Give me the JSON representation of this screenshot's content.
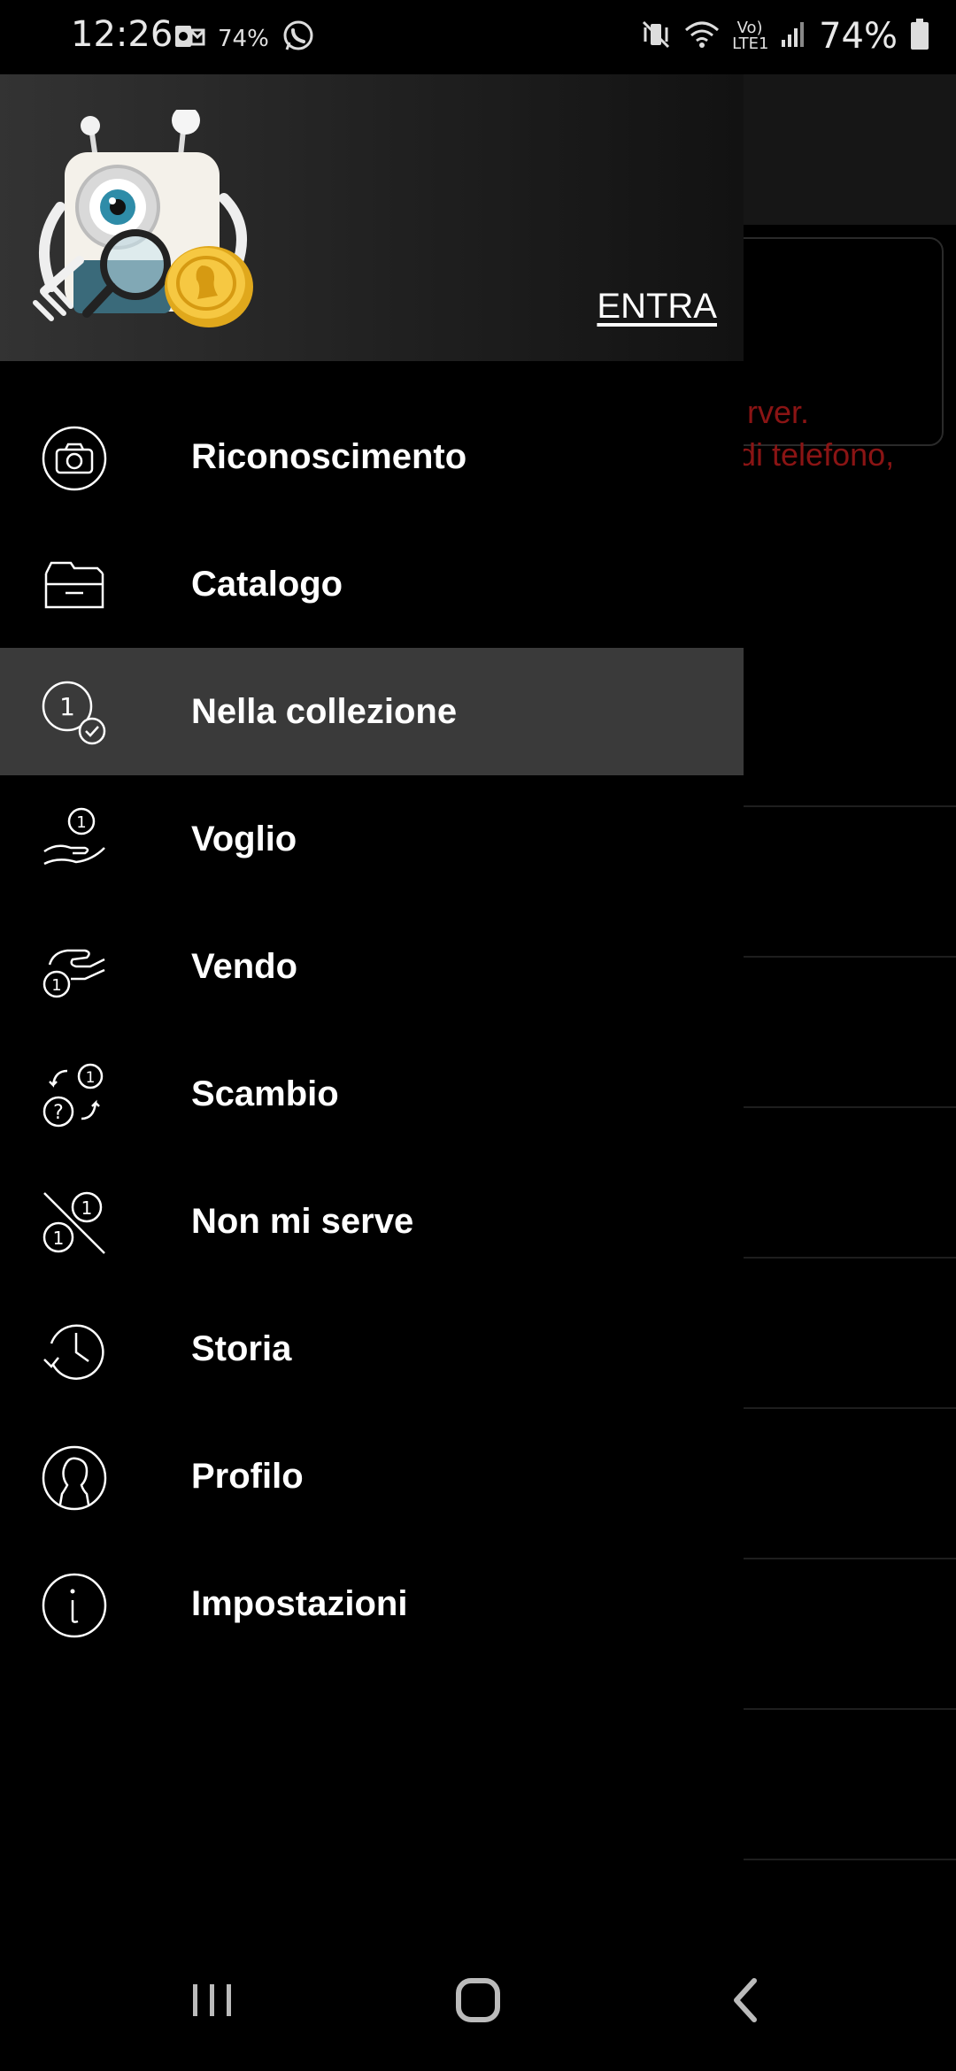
{
  "status_bar": {
    "time": "12:26",
    "small_battery": "74%",
    "battery_percent": "74%",
    "network_label": "Vo) LTE1",
    "icons": [
      "outlook-icon",
      "whatsapp-icon",
      "vibrate-mute-icon",
      "wifi-icon",
      "signal-icon",
      "battery-icon"
    ]
  },
  "background": {
    "error_line1": "rver.",
    "error_line2": "di telefono,",
    "error_color": "#8a1414"
  },
  "drawer": {
    "login_label": "ENTRA",
    "logo_icon": "robot-coin-magnifier-logo",
    "items": [
      {
        "label": "Riconoscimento",
        "icon": "camera-icon"
      },
      {
        "label": "Catalogo",
        "icon": "catalog-drawer-icon"
      },
      {
        "label": "Nella collezione",
        "icon": "coin-check-icon",
        "active": true
      },
      {
        "label": "Voglio",
        "icon": "hand-coin-icon"
      },
      {
        "label": "Vendo",
        "icon": "give-coin-icon"
      },
      {
        "label": "Scambio",
        "icon": "exchange-icon"
      },
      {
        "label": "Non mi serve",
        "icon": "coin-crossed-icon"
      },
      {
        "label": "Storia",
        "icon": "history-icon"
      },
      {
        "label": "Profilo",
        "icon": "profile-icon"
      },
      {
        "label": "Impostazioni",
        "icon": "info-icon"
      }
    ],
    "active_color": "#3a3a3a"
  },
  "nav_bar": {
    "icons": [
      "recent-apps-icon",
      "home-icon",
      "back-icon"
    ]
  }
}
